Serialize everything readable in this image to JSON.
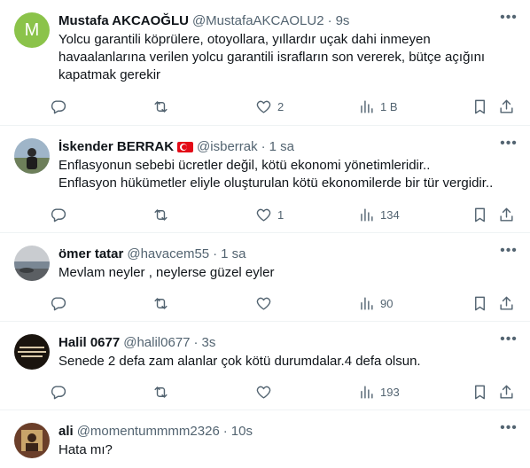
{
  "icons": {
    "reply": "reply-icon",
    "retweet": "retweet-icon",
    "like": "heart-icon",
    "views": "views-bar-icon",
    "bookmark": "bookmark-icon",
    "share": "share-icon",
    "more": "more-dots-icon"
  },
  "colors": {
    "text": "#0f1419",
    "muted": "#536471",
    "divider": "#eff3f4",
    "avatar_m": "#8bc34a"
  },
  "tweets": [
    {
      "avatar_letter": "M",
      "name": "Mustafa AKCAOĞLU",
      "handle": "@MustafaAKCAOLU2",
      "dot": "·",
      "time": "9s",
      "text": "Yolcu garantili köprülere, otoyollara, yıllardır uçak dahi inmeyen havaalanlarına verilen yolcu garantili israfların son vererek, bütçe açığını kapatmak gerekir",
      "reply_count": "",
      "retweet_count": "",
      "like_count": "2",
      "view_count": "1 B"
    },
    {
      "name": "İskender BERRAK",
      "handle": "@isberrak",
      "dot": "·",
      "time": "1 sa",
      "text": "Enflasyonun sebebi ücretler değil, kötü ekonomi yönetimleridir..\nEnflasyon hükümetler eliyle oluşturulan kötü ekonomilerde bir tür vergidir..",
      "reply_count": "",
      "retweet_count": "",
      "like_count": "1",
      "view_count": "134"
    },
    {
      "name": "ömer tatar",
      "handle": "@havacem55",
      "dot": "·",
      "time": "1 sa",
      "text": "Mevlam neyler , neylerse güzel eyler",
      "reply_count": "",
      "retweet_count": "",
      "like_count": "",
      "view_count": "90"
    },
    {
      "name": "Halil 0677",
      "handle": "@halil0677",
      "dot": "·",
      "time": "3s",
      "text": "Senede 2 defa zam alanlar çok kötü durumdalar.4 defa olsun.",
      "reply_count": "",
      "retweet_count": "",
      "like_count": "",
      "view_count": "193"
    },
    {
      "name": "ali",
      "handle": "@momentummmm2326",
      "dot": "·",
      "time": "10s",
      "text": "Hata mı?"
    }
  ]
}
